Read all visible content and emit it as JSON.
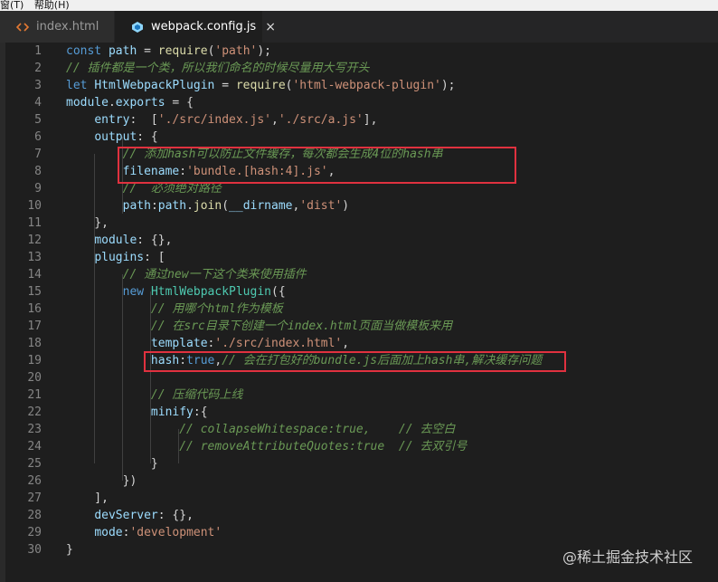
{
  "menubar": {
    "item_left": "窗(T)",
    "item_help": "帮助(H)"
  },
  "tabs": [
    {
      "label": "index.html",
      "icon": "html-tag-icon",
      "active": false
    },
    {
      "label": "webpack.config.js",
      "icon": "webpack-cube-icon",
      "active": true,
      "close": "×"
    }
  ],
  "lines": [
    {
      "n": "1",
      "tokens": [
        [
          "const ",
          "kw"
        ],
        [
          "path",
          "id"
        ],
        [
          " = ",
          "punc"
        ],
        [
          "require",
          "fn"
        ],
        [
          "(",
          "punc"
        ],
        [
          "'path'",
          "str"
        ],
        [
          ");",
          "punc"
        ]
      ]
    },
    {
      "n": "2",
      "tokens": [
        [
          "// 插件都是一个类，所以我们命名的时候尽量用大写开头",
          "cm"
        ]
      ]
    },
    {
      "n": "3",
      "tokens": [
        [
          "let ",
          "kw"
        ],
        [
          "HtmlWebpackPlugin",
          "id"
        ],
        [
          " = ",
          "punc"
        ],
        [
          "require",
          "fn"
        ],
        [
          "(",
          "punc"
        ],
        [
          "'html-webpack-plugin'",
          "str"
        ],
        [
          ");",
          "punc"
        ]
      ]
    },
    {
      "n": "4",
      "tokens": [
        [
          "module",
          "id"
        ],
        [
          ".",
          "punc"
        ],
        [
          "exports",
          "id"
        ],
        [
          " = {",
          "punc"
        ]
      ]
    },
    {
      "n": "5",
      "tokens": [
        [
          "    ",
          "punc"
        ],
        [
          "entry",
          "id"
        ],
        [
          ":  [",
          "punc"
        ],
        [
          "'./src/index.js'",
          "str"
        ],
        [
          ",",
          "punc"
        ],
        [
          "'./src/a.js'",
          "str"
        ],
        [
          "],",
          "punc"
        ]
      ]
    },
    {
      "n": "6",
      "tokens": [
        [
          "    ",
          "punc"
        ],
        [
          "output",
          "id"
        ],
        [
          ": {",
          "punc"
        ]
      ]
    },
    {
      "n": "7",
      "tokens": [
        [
          "        ",
          "punc"
        ],
        [
          "// 添加hash可以防止文件缓存，每次都会生成4位的hash串",
          "cm"
        ]
      ]
    },
    {
      "n": "8",
      "tokens": [
        [
          "        ",
          "punc"
        ],
        [
          "filename",
          "id"
        ],
        [
          ":",
          "punc"
        ],
        [
          "'bundle.[hash:4].js'",
          "str"
        ],
        [
          ",",
          "punc"
        ]
      ]
    },
    {
      "n": "9",
      "tokens": [
        [
          "        ",
          "punc"
        ],
        [
          "//  必须绝对路径",
          "cm"
        ]
      ]
    },
    {
      "n": "10",
      "tokens": [
        [
          "        ",
          "punc"
        ],
        [
          "path",
          "id"
        ],
        [
          ":",
          "punc"
        ],
        [
          "path",
          "id"
        ],
        [
          ".",
          "punc"
        ],
        [
          "join",
          "fn"
        ],
        [
          "(",
          "punc"
        ],
        [
          "__dirname",
          "id"
        ],
        [
          ",",
          "punc"
        ],
        [
          "'dist'",
          "str"
        ],
        [
          ")",
          "punc"
        ]
      ]
    },
    {
      "n": "11",
      "tokens": [
        [
          "    },",
          "punc"
        ]
      ]
    },
    {
      "n": "12",
      "tokens": [
        [
          "    ",
          "punc"
        ],
        [
          "module",
          "id"
        ],
        [
          ": {},",
          "punc"
        ]
      ]
    },
    {
      "n": "13",
      "tokens": [
        [
          "    ",
          "punc"
        ],
        [
          "plugins",
          "id"
        ],
        [
          ": [",
          "punc"
        ]
      ]
    },
    {
      "n": "14",
      "tokens": [
        [
          "        ",
          "punc"
        ],
        [
          "// 通过new一下这个类来使用插件",
          "cm"
        ]
      ]
    },
    {
      "n": "15",
      "tokens": [
        [
          "        ",
          "punc"
        ],
        [
          "new ",
          "kw"
        ],
        [
          "HtmlWebpackPlugin",
          "cls"
        ],
        [
          "({",
          "punc"
        ]
      ]
    },
    {
      "n": "16",
      "tokens": [
        [
          "            ",
          "punc"
        ],
        [
          "// 用哪个html作为模板",
          "cm"
        ]
      ]
    },
    {
      "n": "17",
      "tokens": [
        [
          "            ",
          "punc"
        ],
        [
          "// 在src目录下创建一个index.html页面当做模板来用",
          "cm"
        ]
      ]
    },
    {
      "n": "18",
      "tokens": [
        [
          "            ",
          "punc"
        ],
        [
          "template",
          "id"
        ],
        [
          ":",
          "punc"
        ],
        [
          "'./src/index.html'",
          "str"
        ],
        [
          ",",
          "punc"
        ]
      ]
    },
    {
      "n": "19",
      "tokens": [
        [
          "            ",
          "punc"
        ],
        [
          "hash",
          "id"
        ],
        [
          ":",
          "punc"
        ],
        [
          "true",
          "kw"
        ],
        [
          ",",
          "punc"
        ],
        [
          "// 会在打包好的bundle.js后面加上hash串,解决缓存问题",
          "cm"
        ]
      ]
    },
    {
      "n": "20",
      "tokens": []
    },
    {
      "n": "21",
      "tokens": [
        [
          "            ",
          "punc"
        ],
        [
          "// 压缩代码上线",
          "cm"
        ]
      ]
    },
    {
      "n": "22",
      "tokens": [
        [
          "            ",
          "punc"
        ],
        [
          "minify",
          "id"
        ],
        [
          ":{",
          "punc"
        ]
      ]
    },
    {
      "n": "23",
      "tokens": [
        [
          "                ",
          "punc"
        ],
        [
          "// collapseWhitespace:true,    // 去空白",
          "cm"
        ]
      ]
    },
    {
      "n": "24",
      "tokens": [
        [
          "                ",
          "punc"
        ],
        [
          "// removeAttributeQuotes:true  // 去双引号",
          "cm"
        ]
      ]
    },
    {
      "n": "25",
      "tokens": [
        [
          "            }",
          "punc"
        ]
      ]
    },
    {
      "n": "26",
      "tokens": [
        [
          "        })",
          "punc"
        ]
      ]
    },
    {
      "n": "27",
      "tokens": [
        [
          "    ],",
          "punc"
        ]
      ]
    },
    {
      "n": "28",
      "tokens": [
        [
          "    ",
          "punc"
        ],
        [
          "devServer",
          "id"
        ],
        [
          ": {},",
          "punc"
        ]
      ]
    },
    {
      "n": "29",
      "tokens": [
        [
          "    ",
          "punc"
        ],
        [
          "mode",
          "id"
        ],
        [
          ":",
          "punc"
        ],
        [
          "'development'",
          "str"
        ]
      ]
    },
    {
      "n": "30",
      "tokens": [
        [
          "}",
          "punc"
        ]
      ]
    }
  ],
  "highlight_color": "#e0313f",
  "watermark": "@稀土掘金技术社区"
}
